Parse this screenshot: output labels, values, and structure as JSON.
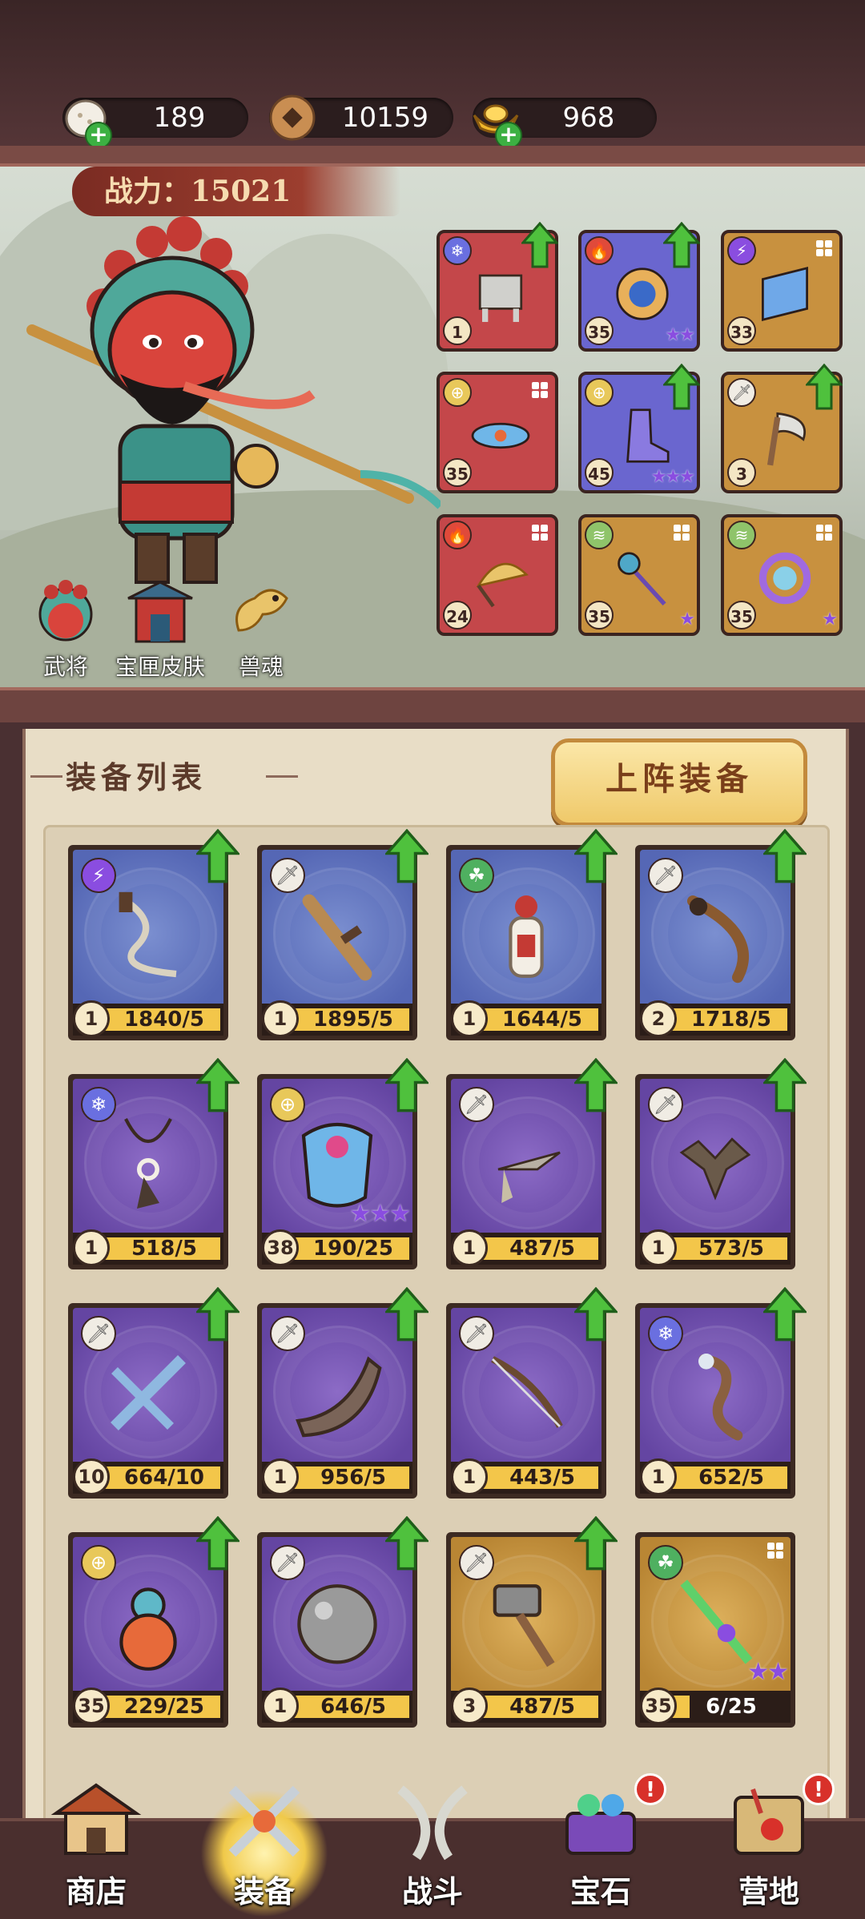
{
  "currencies": [
    {
      "icon": "egg-icon",
      "value": "189"
    },
    {
      "icon": "coin-icon",
      "value": "10159"
    },
    {
      "icon": "gold-ingot-icon",
      "value": "968"
    }
  ],
  "hero": {
    "power_label": "战力：15021",
    "links": [
      {
        "icon": "general-helmet-icon",
        "label": "武将"
      },
      {
        "icon": "treasure-box-skin-icon",
        "label": "宝匣皮肤"
      },
      {
        "icon": "beast-soul-icon",
        "label": "兽魂"
      }
    ],
    "slots": [
      {
        "color": "red",
        "element": "ice",
        "item": "cauldron-icon",
        "level": "1",
        "upgrade": true,
        "stars": 0
      },
      {
        "color": "blue",
        "element": "fire",
        "item": "wheel-icon",
        "level": "35",
        "upgrade": true,
        "stars": 2
      },
      {
        "color": "gold",
        "element": "lightning",
        "item": "scroll-icon",
        "level": "33",
        "upgrade": false,
        "stars": 0
      },
      {
        "color": "red",
        "element": "target",
        "item": "belt-icon",
        "level": "35",
        "upgrade": false,
        "stars": 0
      },
      {
        "color": "blue",
        "element": "target",
        "item": "boots-icon",
        "level": "45",
        "upgrade": true,
        "stars": 3
      },
      {
        "color": "gold",
        "element": "sword",
        "item": "axe-icon",
        "level": "3",
        "upgrade": true,
        "stars": 0
      },
      {
        "color": "red",
        "element": "fire",
        "item": "fan-icon",
        "level": "24",
        "upgrade": false,
        "stars": 0
      },
      {
        "color": "gold",
        "element": "wind",
        "item": "scepter-icon",
        "level": "35",
        "upgrade": false,
        "stars": 1
      },
      {
        "color": "gold",
        "element": "wind",
        "item": "ring-icon",
        "level": "35",
        "upgrade": false,
        "stars": 1
      }
    ]
  },
  "equipment": {
    "title": "装备列表",
    "deploy_button": "上阵装备",
    "items": [
      {
        "color": "blue",
        "element": "lightning",
        "item": "whip-icon",
        "level": "1",
        "progress": "1840/5",
        "fill": 1.0,
        "upgrade": true,
        "stars": 0
      },
      {
        "color": "blue",
        "element": "sword",
        "item": "wooden-sword-icon",
        "level": "1",
        "progress": "1895/5",
        "fill": 1.0,
        "upgrade": true,
        "stars": 0
      },
      {
        "color": "blue",
        "element": "poison",
        "item": "potion-bottle-icon",
        "level": "1",
        "progress": "1644/5",
        "fill": 1.0,
        "upgrade": true,
        "stars": 0
      },
      {
        "color": "blue",
        "element": "sword",
        "item": "sabre-icon",
        "level": "2",
        "progress": "1718/5",
        "fill": 1.0,
        "upgrade": true,
        "stars": 0
      },
      {
        "color": "purple",
        "element": "ice",
        "item": "pendant-icon",
        "level": "1",
        "progress": "518/5",
        "fill": 1.0,
        "upgrade": true,
        "stars": 0
      },
      {
        "color": "purple",
        "element": "target",
        "item": "armor-icon",
        "level": "38",
        "progress": "190/25",
        "fill": 1.0,
        "upgrade": true,
        "stars": 3
      },
      {
        "color": "purple",
        "element": "sword",
        "item": "dart-icon",
        "level": "1",
        "progress": "487/5",
        "fill": 1.0,
        "upgrade": true,
        "stars": 0
      },
      {
        "color": "purple",
        "element": "sword",
        "item": "caltrops-icon",
        "level": "1",
        "progress": "573/5",
        "fill": 1.0,
        "upgrade": true,
        "stars": 0
      },
      {
        "color": "purple",
        "element": "sword",
        "item": "crossbow-icon",
        "level": "10",
        "progress": "664/10",
        "fill": 1.0,
        "upgrade": true,
        "stars": 0
      },
      {
        "color": "purple",
        "element": "sword",
        "item": "boomerang-icon",
        "level": "1",
        "progress": "956/5",
        "fill": 1.0,
        "upgrade": true,
        "stars": 0
      },
      {
        "color": "purple",
        "element": "sword",
        "item": "bow-icon",
        "level": "1",
        "progress": "443/5",
        "fill": 1.0,
        "upgrade": true,
        "stars": 0
      },
      {
        "color": "purple",
        "element": "ice",
        "item": "staff-icon",
        "level": "1",
        "progress": "652/5",
        "fill": 1.0,
        "upgrade": true,
        "stars": 0
      },
      {
        "color": "purple",
        "element": "target",
        "item": "gourd-icon",
        "level": "35",
        "progress": "229/25",
        "fill": 1.0,
        "upgrade": true,
        "stars": 0
      },
      {
        "color": "purple",
        "element": "sword",
        "item": "iron-ball-icon",
        "level": "1",
        "progress": "646/5",
        "fill": 1.0,
        "upgrade": true,
        "stars": 0
      },
      {
        "color": "gold",
        "element": "sword",
        "item": "hammer-icon",
        "level": "3",
        "progress": "487/5",
        "fill": 1.0,
        "upgrade": true,
        "stars": 0
      },
      {
        "color": "gold",
        "element": "poison",
        "item": "jade-sword-icon",
        "level": "35",
        "progress": "6/25",
        "fill": 0.24,
        "upgrade": false,
        "stars": 2
      }
    ]
  },
  "nav": [
    {
      "icon": "shop-icon",
      "label": "商店",
      "active": false,
      "badge": ""
    },
    {
      "icon": "equipment-icon",
      "label": "装备",
      "active": true,
      "badge": ""
    },
    {
      "icon": "battle-icon",
      "label": "战斗",
      "active": false,
      "badge": ""
    },
    {
      "icon": "gem-chest-icon",
      "label": "宝石",
      "active": false,
      "badge": "!"
    },
    {
      "icon": "camp-icon",
      "label": "营地",
      "active": false,
      "badge": "!"
    }
  ],
  "colors": {
    "slot_red": "#c4474a",
    "slot_blue": "#6a66cf",
    "slot_gold": "#c8913f",
    "upgrade_green": "#4fc13d",
    "progress_yellow": "#f3c64a",
    "badge_red": "#d8312a"
  }
}
